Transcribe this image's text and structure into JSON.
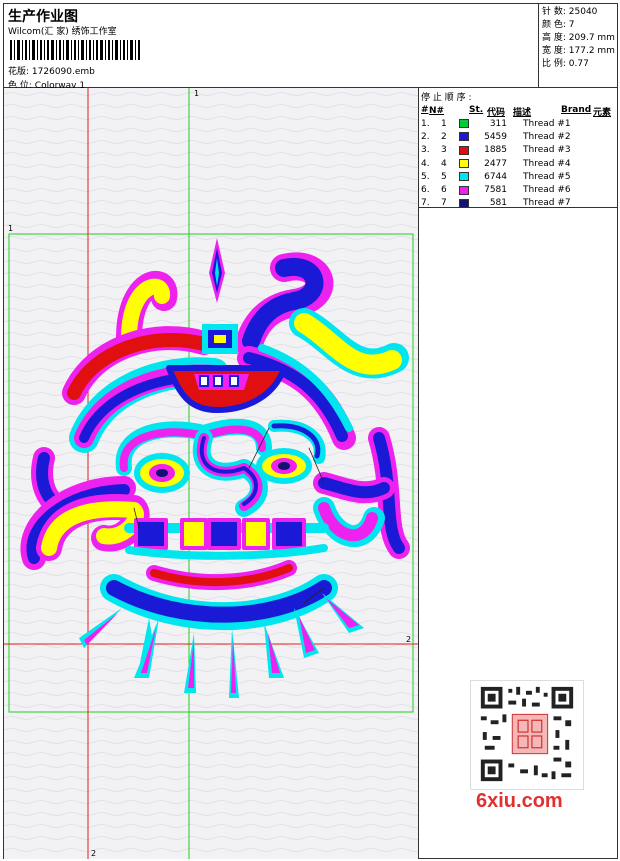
{
  "header": {
    "title": "生产作业图",
    "subtitle": "Wilcom(汇 家) 绣饰工作室",
    "pattern_label": "花版:",
    "pattern_value": "1726090.emb",
    "colorway_label": "色 位:",
    "colorway_value": "Colorway 1"
  },
  "stats": [
    {
      "label": "针 数:",
      "value": "25040"
    },
    {
      "label": "颜 色:",
      "value": "7"
    },
    {
      "label": "高 度:",
      "value": "209.7 mm"
    },
    {
      "label": "宽 度:",
      "value": "177.2 mm"
    },
    {
      "label": "比 例:",
      "value": "0.77"
    }
  ],
  "threads": {
    "title": "停 止 顺 序 :",
    "headers": [
      "#",
      "N#",
      "St.",
      "代码",
      "描述",
      "Brand",
      "元素"
    ],
    "rows": [
      {
        "stop": "1.",
        "n": "1",
        "code": "311",
        "desc": "Thread #1",
        "color": "#00cc33"
      },
      {
        "stop": "2.",
        "n": "2",
        "code": "5459",
        "desc": "Thread #2",
        "color": "#1a1ad6"
      },
      {
        "stop": "3.",
        "n": "3",
        "code": "1885",
        "desc": "Thread #3",
        "color": "#e01010"
      },
      {
        "stop": "4.",
        "n": "4",
        "code": "2477",
        "desc": "Thread #4",
        "color": "#ffff00"
      },
      {
        "stop": "5.",
        "n": "5",
        "code": "6744",
        "desc": "Thread #5",
        "color": "#00e5ee"
      },
      {
        "stop": "6.",
        "n": "6",
        "code": "7581",
        "desc": "Thread #6",
        "color": "#ee22ee"
      },
      {
        "stop": "7.",
        "n": "7",
        "code": "581",
        "desc": "Thread #7",
        "color": "#121270"
      }
    ]
  },
  "guides": {
    "label_top": "1",
    "label_left": "1",
    "label_right": "2",
    "label_bottom": "2"
  },
  "watermark": {
    "text": "6xiu.com"
  },
  "icons": {
    "qr": "qr-code-icon",
    "barcode": "barcode-icon"
  }
}
